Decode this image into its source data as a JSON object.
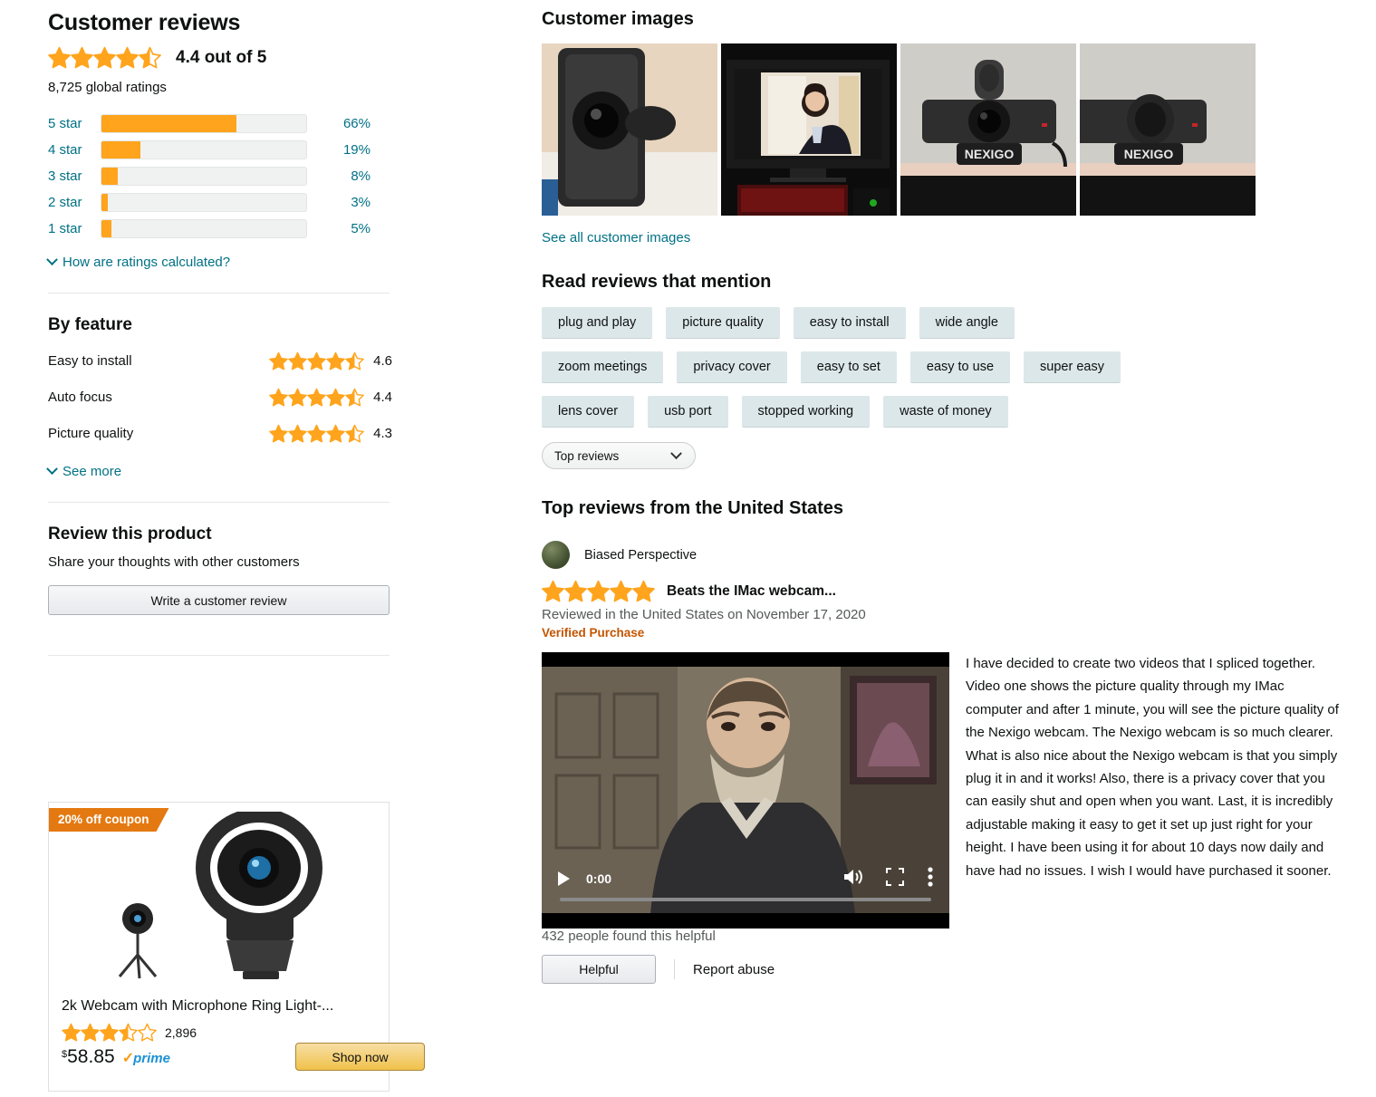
{
  "left": {
    "title": "Customer reviews",
    "overall_rating_text": "4.4 out of 5",
    "overall_rating_value": 4.4,
    "global_ratings": "8,725 global ratings",
    "histogram": [
      {
        "label": "5 star",
        "pct": "66%",
        "value": 66
      },
      {
        "label": "4 star",
        "pct": "19%",
        "value": 19
      },
      {
        "label": "3 star",
        "pct": "8%",
        "value": 8
      },
      {
        "label": "2 star",
        "pct": "3%",
        "value": 3
      },
      {
        "label": "1 star",
        "pct": "5%",
        "value": 5
      }
    ],
    "how_calculated_link": "How are ratings calculated?",
    "by_feature_title": "By feature",
    "features": [
      {
        "name": "Easy to install",
        "score": "4.6",
        "value": 4.6
      },
      {
        "name": "Auto focus",
        "score": "4.4",
        "value": 4.4
      },
      {
        "name": "Picture quality",
        "score": "4.3",
        "value": 4.3
      }
    ],
    "see_more_link": "See more",
    "review_product_title": "Review this product",
    "share_thoughts": "Share your thoughts with other customers",
    "write_review_button": "Write a customer review"
  },
  "ad": {
    "coupon_badge": "20% off coupon",
    "product_title": "2k Webcam with Microphone Ring Light-...",
    "rating_value": 3.5,
    "review_count": "2,896",
    "currency_symbol": "$",
    "price": "58.85",
    "prime_check": "✓",
    "prime_label": "prime",
    "shop_now_button": "Shop now"
  },
  "right": {
    "customer_images_title": "Customer images",
    "see_all_images_link": "See all customer images",
    "mention_title": "Read reviews that mention",
    "mention_tags": [
      [
        "plug and play",
        "picture quality",
        "easy to install",
        "wide angle"
      ],
      [
        "zoom meetings",
        "privacy cover",
        "easy to set",
        "easy to use",
        "super easy"
      ],
      [
        "lens cover",
        "usb port",
        "stopped working",
        "waste of money"
      ]
    ],
    "sort_value": "Top reviews",
    "top_reviews_title": "Top reviews from the United States"
  },
  "review": {
    "author": "Biased Perspective",
    "stars_value": 5,
    "title": "Beats the IMac webcam...",
    "meta": "Reviewed in the United States on November 17, 2020",
    "verified": "Verified Purchase",
    "body": " I have decided to create two videos that I spliced together. Video one shows the picture quality through my IMac computer and after 1 minute, you will see the picture quality of the Nexigo webcam. The Nexigo webcam is so much clearer. What is also nice about the Nexigo webcam is that you simply plug it in and it works! Also, there is a privacy cover that you can easily shut and open when you want. Last, it is incredibly adjustable making it easy to get it set up just right for your height. I have been using it for about 10 days now daily and have had no issues. I wish I would have purchased it sooner.",
    "video_time": "0:00",
    "helpful_count_text": "432 people found this helpful",
    "helpful_button": "Helpful",
    "report_abuse": "Report abuse"
  },
  "colors": {
    "star": "#FFA41C",
    "link": "#007185",
    "verified": "#C45500",
    "coupon": "#E47911",
    "tag_bg": "#DCE7E9"
  }
}
